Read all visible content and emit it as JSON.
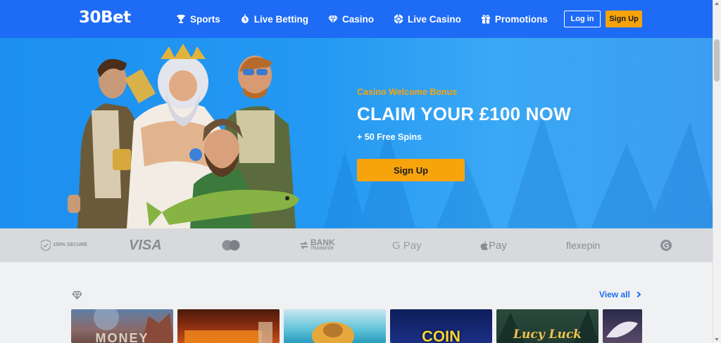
{
  "brand": {
    "logo": "30Bet"
  },
  "nav": {
    "items": [
      {
        "label": "Sports",
        "icon": "trophy-icon"
      },
      {
        "label": "Live Betting",
        "icon": "stopwatch-icon"
      },
      {
        "label": "Casino",
        "icon": "diamond-icon"
      },
      {
        "label": "Live Casino",
        "icon": "chip-icon"
      },
      {
        "label": "Promotions",
        "icon": "gift-icon"
      }
    ],
    "login_label": "Log in",
    "signup_label": "Sign Up"
  },
  "hero": {
    "subtitle": "Casino Welcome Bonus",
    "title": "CLAIM YOUR £100 NOW",
    "spins": "+ 50 Free Spins",
    "cta_label": "Sign Up"
  },
  "payments": {
    "secure": "100% SECURE",
    "visa": "VISA",
    "bank_line1": "BANK",
    "bank_line2": "TRANSFER",
    "gpay": "G Pay",
    "applepay": "Pay",
    "flexepin": "flexepin"
  },
  "section": {
    "view_all_label": "View all",
    "tiles": [
      {
        "label": "MONEY"
      },
      {
        "label": ""
      },
      {
        "label": ""
      },
      {
        "label": "COIN"
      },
      {
        "label": "Lucy Luck"
      },
      {
        "label": ""
      }
    ]
  },
  "colors": {
    "header_bg": "#1e6bf5",
    "accent": "#f7a40c",
    "link": "#1e6bf5"
  }
}
